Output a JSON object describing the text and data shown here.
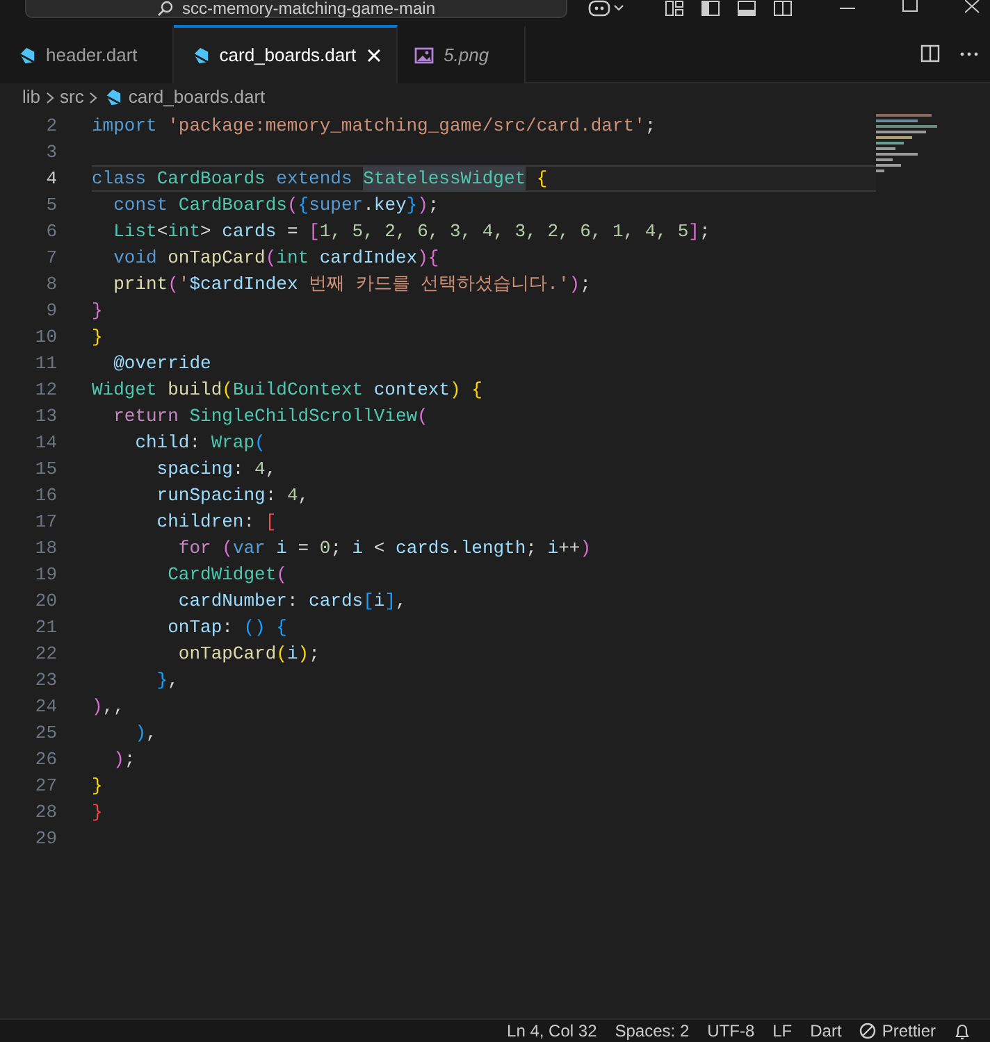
{
  "title_bar": {
    "search_text": "scc-memory-matching-game-main"
  },
  "tabs": [
    {
      "label": "header.dart",
      "kind": "dart",
      "selected": false,
      "preview": false
    },
    {
      "label": "card_boards.dart",
      "kind": "dart",
      "selected": true,
      "preview": false
    },
    {
      "label": "5.png",
      "kind": "image",
      "selected": false,
      "preview": true
    }
  ],
  "breadcrumb": [
    "lib",
    "src",
    "card_boards.dart"
  ],
  "editor": {
    "lines": [
      {
        "number": "2",
        "current": false,
        "tokens": [
          {
            "kind": "kw",
            "text": "import "
          },
          {
            "kind": "str",
            "text": "'package:memory_matching_game/src/card.dart'"
          },
          {
            "kind": "p",
            "text": ";"
          }
        ]
      },
      {
        "number": "3",
        "current": false
      },
      {
        "number": "4",
        "current": true,
        "tokens": [
          {
            "kind": "kw",
            "text": "class "
          },
          {
            "kind": "type",
            "text": "CardBoards "
          },
          {
            "kind": "kw",
            "text": "extends "
          },
          {
            "kind": "sel",
            "text": "StatelessWidget"
          },
          {
            "kind": "b1",
            "text": " {"
          }
        ]
      },
      {
        "number": "5",
        "current": false,
        "tokens": [
          {
            "kind": "kw",
            "text": "  const "
          },
          {
            "kind": "type",
            "text": "CardBoards"
          },
          {
            "kind": "b2",
            "text": "("
          },
          {
            "kind": "b3",
            "text": "{"
          },
          {
            "kind": "kw",
            "text": "super"
          },
          {
            "kind": "p",
            "text": "."
          },
          {
            "kind": "var",
            "text": "key"
          },
          {
            "kind": "b3",
            "text": "}"
          },
          {
            "kind": "b2",
            "text": ")"
          },
          {
            "kind": "p",
            "text": ";"
          }
        ]
      },
      {
        "number": "6",
        "current": false,
        "tokens": [
          {
            "kind": "type",
            "text": "  List"
          },
          {
            "kind": "p",
            "text": "<"
          },
          {
            "kind": "type",
            "text": "int"
          },
          {
            "kind": "p",
            "text": "> "
          },
          {
            "kind": "var",
            "text": "cards"
          },
          {
            "kind": "p",
            "text": " = "
          },
          {
            "kind": "b2",
            "text": "["
          },
          {
            "kind": "num",
            "text": "1, 5, 2, 6, 3, 4, 3, 2, 6, 1, 4, 5"
          },
          {
            "kind": "b2",
            "text": "]"
          },
          {
            "kind": "p",
            "text": ";"
          }
        ]
      },
      {
        "number": "7",
        "current": false,
        "tokens": [
          {
            "kind": "kw",
            "text": "  void "
          },
          {
            "kind": "fn",
            "text": "onTapCard"
          },
          {
            "kind": "b2",
            "text": "("
          },
          {
            "kind": "type",
            "text": "int "
          },
          {
            "kind": "var",
            "text": "cardIndex"
          },
          {
            "kind": "b2",
            "text": "){"
          }
        ]
      },
      {
        "number": "8",
        "current": false,
        "tokens": [
          {
            "kind": "fn",
            "text": "  print"
          },
          {
            "kind": "b2",
            "text": "("
          },
          {
            "kind": "str",
            "text": "'"
          },
          {
            "kind": "var",
            "text": "$cardIndex"
          },
          {
            "kind": "str",
            "text": " 번째 카드를 선택하셨습니다.'"
          },
          {
            "kind": "b2",
            "text": ")"
          },
          {
            "kind": "p",
            "text": ";"
          }
        ]
      },
      {
        "number": "9",
        "current": false,
        "tokens": [
          {
            "kind": "b2",
            "text": "}"
          }
        ]
      },
      {
        "number": "10",
        "current": false,
        "tokens": [
          {
            "kind": "b1",
            "text": "}"
          }
        ]
      },
      {
        "number": "11",
        "current": false,
        "tokens": [
          {
            "kind": "var",
            "text": "  @override"
          }
        ]
      },
      {
        "number": "12",
        "current": false,
        "tokens": [
          {
            "kind": "type",
            "text": "Widget "
          },
          {
            "kind": "fn",
            "text": "build"
          },
          {
            "kind": "b1",
            "text": "("
          },
          {
            "kind": "type",
            "text": "BuildContext "
          },
          {
            "kind": "var",
            "text": "context"
          },
          {
            "kind": "b1",
            "text": ") {"
          }
        ]
      },
      {
        "number": "13",
        "current": false,
        "tokens": [
          {
            "kind": "ctrl",
            "text": "  return "
          },
          {
            "kind": "type",
            "text": "SingleChildScrollView"
          },
          {
            "kind": "b2",
            "text": "("
          }
        ]
      },
      {
        "number": "14",
        "current": false,
        "tokens": [
          {
            "kind": "var",
            "text": "    child"
          },
          {
            "kind": "p",
            "text": ": "
          },
          {
            "kind": "type",
            "text": "Wrap"
          },
          {
            "kind": "b3",
            "text": "("
          }
        ]
      },
      {
        "number": "15",
        "current": false,
        "tokens": [
          {
            "kind": "var",
            "text": "      spacing"
          },
          {
            "kind": "p",
            "text": ": "
          },
          {
            "kind": "num",
            "text": "4"
          },
          {
            "kind": "p",
            "text": ","
          }
        ]
      },
      {
        "number": "16",
        "current": false,
        "tokens": [
          {
            "kind": "var",
            "text": "      runSpacing"
          },
          {
            "kind": "p",
            "text": ": "
          },
          {
            "kind": "num",
            "text": "4"
          },
          {
            "kind": "p",
            "text": ","
          }
        ]
      },
      {
        "number": "17",
        "current": false,
        "tokens": [
          {
            "kind": "var",
            "text": "      children"
          },
          {
            "kind": "p",
            "text": ": "
          },
          {
            "kind": "err",
            "text": "["
          }
        ]
      },
      {
        "number": "18",
        "current": false,
        "tokens": [
          {
            "kind": "ctrl",
            "text": "        for "
          },
          {
            "kind": "b2",
            "text": "("
          },
          {
            "kind": "kw",
            "text": "var "
          },
          {
            "kind": "var",
            "text": "i"
          },
          {
            "kind": "p",
            "text": " = "
          },
          {
            "kind": "num",
            "text": "0"
          },
          {
            "kind": "p",
            "text": "; "
          },
          {
            "kind": "var",
            "text": "i"
          },
          {
            "kind": "p",
            "text": " < "
          },
          {
            "kind": "var",
            "text": "cards"
          },
          {
            "kind": "p",
            "text": "."
          },
          {
            "kind": "var",
            "text": "length"
          },
          {
            "kind": "p",
            "text": "; "
          },
          {
            "kind": "var",
            "text": "i"
          },
          {
            "kind": "p",
            "text": "++"
          },
          {
            "kind": "b2",
            "text": ")"
          }
        ]
      },
      {
        "number": "19",
        "current": false,
        "tokens": [
          {
            "kind": "type",
            "text": "       CardWidget"
          },
          {
            "kind": "b2",
            "text": "("
          }
        ]
      },
      {
        "number": "20",
        "current": false,
        "tokens": [
          {
            "kind": "var",
            "text": "        cardNumber"
          },
          {
            "kind": "p",
            "text": ": "
          },
          {
            "kind": "var",
            "text": "cards"
          },
          {
            "kind": "b3",
            "text": "["
          },
          {
            "kind": "var",
            "text": "i"
          },
          {
            "kind": "b3",
            "text": "]"
          },
          {
            "kind": "p",
            "text": ","
          }
        ]
      },
      {
        "number": "21",
        "current": false,
        "tokens": [
          {
            "kind": "var",
            "text": "       onTap"
          },
          {
            "kind": "p",
            "text": ": "
          },
          {
            "kind": "b3",
            "text": "() {"
          }
        ]
      },
      {
        "number": "22",
        "current": false,
        "tokens": [
          {
            "kind": "fn",
            "text": "        onTapCard"
          },
          {
            "kind": "b1",
            "text": "("
          },
          {
            "kind": "var",
            "text": "i"
          },
          {
            "kind": "b1",
            "text": ")"
          },
          {
            "kind": "p",
            "text": ";"
          }
        ]
      },
      {
        "number": "23",
        "current": false,
        "tokens": [
          {
            "kind": "b3",
            "text": "      }"
          },
          {
            "kind": "p",
            "text": ","
          }
        ]
      },
      {
        "number": "24",
        "current": false,
        "tokens": [
          {
            "kind": "b2",
            "text": ")"
          },
          {
            "kind": "p",
            "text": ",,"
          }
        ]
      },
      {
        "number": "25",
        "current": false,
        "tokens": [
          {
            "kind": "b3",
            "text": "    )"
          },
          {
            "kind": "p",
            "text": ","
          }
        ]
      },
      {
        "number": "26",
        "current": false,
        "tokens": [
          {
            "kind": "b2",
            "text": "  )"
          },
          {
            "kind": "p",
            "text": ";"
          }
        ]
      },
      {
        "number": "27",
        "current": false,
        "tokens": [
          {
            "kind": "b1",
            "text": "}"
          }
        ]
      },
      {
        "number": "28",
        "current": false,
        "tokens": [
          {
            "kind": "err",
            "text": "}"
          }
        ]
      },
      {
        "number": "29",
        "current": false
      }
    ]
  },
  "status_bar": [
    {
      "kind": "text",
      "label": "Ln 4, Col 32"
    },
    {
      "kind": "text",
      "label": "Spaces: 2"
    },
    {
      "kind": "text",
      "label": "UTF-8"
    },
    {
      "kind": "text",
      "label": "LF"
    },
    {
      "kind": "text",
      "label": "Dart"
    },
    {
      "kind": "prettier",
      "label": "Prettier"
    },
    {
      "kind": "bell"
    }
  ]
}
